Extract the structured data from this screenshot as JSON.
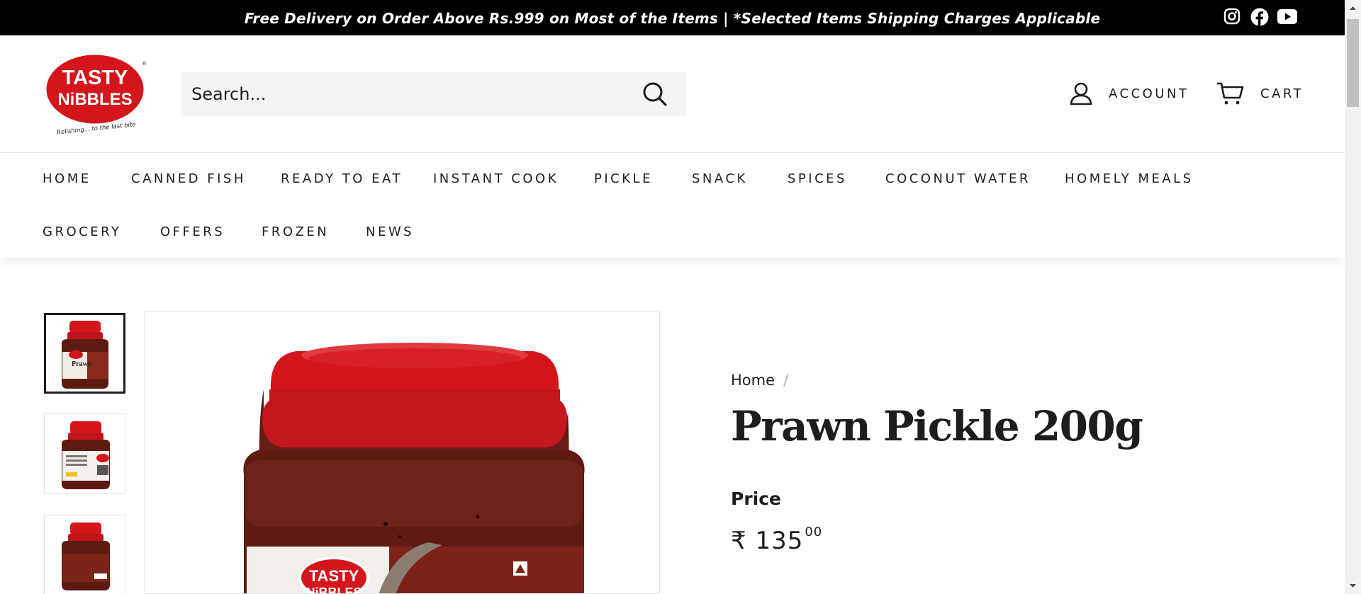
{
  "announcement": {
    "text": "Free Delivery on Order Above Rs.999 on Most of the Items | *Selected Items Shipping Charges Applicable"
  },
  "social_icons": [
    "instagram-icon",
    "facebook-icon",
    "youtube-icon"
  ],
  "logo": {
    "line1": "TASTY",
    "line2": "NiBBLES",
    "tagline": "Relishing... to the last bite"
  },
  "search": {
    "placeholder": "Search..."
  },
  "header_links": {
    "account": "ACCOUNT",
    "cart": "CART"
  },
  "nav": {
    "row1": [
      "HOME",
      "CANNED FISH",
      "READY TO EAT",
      "INSTANT COOK",
      "PICKLE",
      "SNACK",
      "SPICES",
      "COCONUT WATER",
      "HOMELY MEALS"
    ],
    "row2": [
      "GROCERY",
      "OFFERS",
      "FROZEN",
      "NEWS"
    ]
  },
  "breadcrumb": {
    "home": "Home",
    "separator": "/"
  },
  "product": {
    "title": "Prawn Pickle 200g",
    "price_label": "Price",
    "currency": "₹",
    "price_major": "135",
    "price_minor": "00",
    "jar_label_line1": "TASTY",
    "jar_label_line2": "NiBBLES",
    "thumb_label": "Prawn"
  },
  "colors": {
    "announcement_bg": "#000000",
    "brand_red": "#d4161c",
    "search_bg": "#f5f5f5",
    "text": "#1c1d1d"
  }
}
